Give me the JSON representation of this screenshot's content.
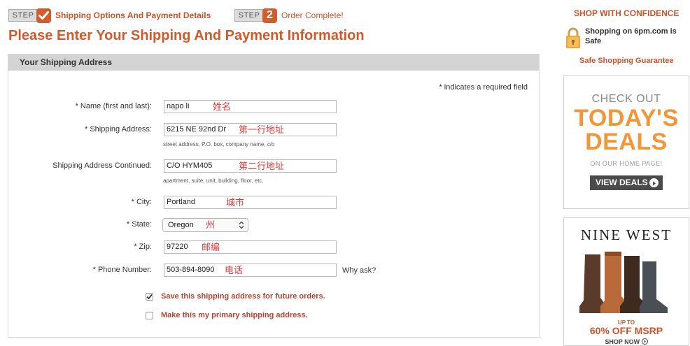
{
  "steps": {
    "step1": {
      "box_label": "STEP",
      "label": "Shipping Options And Payment Details"
    },
    "step2": {
      "box_label": "STEP",
      "number": "2",
      "label": "Order Complete!"
    }
  },
  "page_title": "Please Enter Your Shipping And Payment Information",
  "form": {
    "section_title": "Your Shipping Address",
    "required_note": "* indicates a required field",
    "name": {
      "label": "* Name (first and last):",
      "value": "napo li",
      "annotation": "姓名"
    },
    "shipping_address": {
      "label": "* Shipping Address:",
      "value": "6215 NE 92nd Dr",
      "annotation": "第一行地址",
      "hint": "street address, P.O. box, company name, c/o"
    },
    "shipping_address_continued": {
      "label": "Shipping Address Continued:",
      "value": "C/O HYM405",
      "annotation": "第二行地址",
      "hint": "apartment, suite, unit, building, floor, etc."
    },
    "city": {
      "label": "* City:",
      "value": "Portland",
      "annotation": "城市"
    },
    "state": {
      "label": "* State:",
      "value": "Oregon",
      "annotation": "州"
    },
    "zip": {
      "label": "* Zip:",
      "value": "97220",
      "annotation": "邮编"
    },
    "phone": {
      "label": "* Phone Number:",
      "value": "503-894-8090",
      "annotation": "电话",
      "why_ask": "Why ask?"
    },
    "save_address": {
      "label": "Save this shipping address for future orders.",
      "checked": true
    },
    "primary_address": {
      "label": "Make this my primary shipping address.",
      "checked": false
    }
  },
  "sidebar": {
    "confidence_title": "SHOP WITH CONFIDENCE",
    "safe_text": "Shopping on 6pm.com is Safe",
    "guarantee_link": "Safe Shopping Guarantee",
    "deals_ad": {
      "check_out": "CHECK OUT",
      "line1": "TODAY'S",
      "line2": "DEALS",
      "home_page": "ON OUR HOME PAGE!",
      "button": "VIEW DEALS"
    },
    "nine_west_ad": {
      "brand": "NINE WEST",
      "up_to": "UP TO",
      "offer": "60% OFF MSRP",
      "shop_now": "SHOP NOW"
    }
  },
  "colors": {
    "accent": "#cf5a2c",
    "annotation": "#e03c3c",
    "checkbox_label": "#b24434",
    "deals_orange": "#f0973a"
  }
}
